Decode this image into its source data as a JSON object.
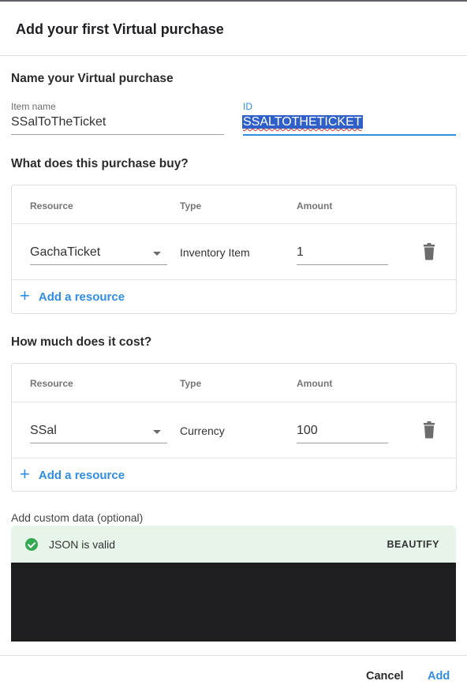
{
  "dialog": {
    "title": "Add your first Virtual purchase"
  },
  "name_section": {
    "title": "Name your Virtual purchase",
    "item_name_label": "Item name",
    "item_name_value": "SSalToTheTicket",
    "id_label": "ID",
    "id_value": "SSALTOTHETICKET"
  },
  "buy_section": {
    "title": "What does this purchase buy?",
    "columns": [
      "Resource",
      "Type",
      "Amount"
    ],
    "rows": [
      {
        "resource": "GachaTicket",
        "type": "Inventory Item",
        "amount": "1",
        "delete_icon": "trash-icon"
      }
    ],
    "add_label": "Add a resource"
  },
  "cost_section": {
    "title": "How much does it cost?",
    "columns": [
      "Resource",
      "Type",
      "Amount"
    ],
    "rows": [
      {
        "resource": "SSal",
        "type": "Currency",
        "amount": "100",
        "delete_icon": "trash-icon"
      }
    ],
    "add_label": "Add a resource"
  },
  "custom_data": {
    "label": "Add custom data (optional)",
    "status": "JSON is valid",
    "status_icon": "check-circle-icon",
    "beautify_label": "BEAUTIFY"
  },
  "footer": {
    "cancel_label": "Cancel",
    "add_label": "Add"
  },
  "colors": {
    "accent": "#2f8de4",
    "valid_bg": "#e6f4ea",
    "valid_icon": "#34a853",
    "editor_bg": "#1e1e20"
  }
}
